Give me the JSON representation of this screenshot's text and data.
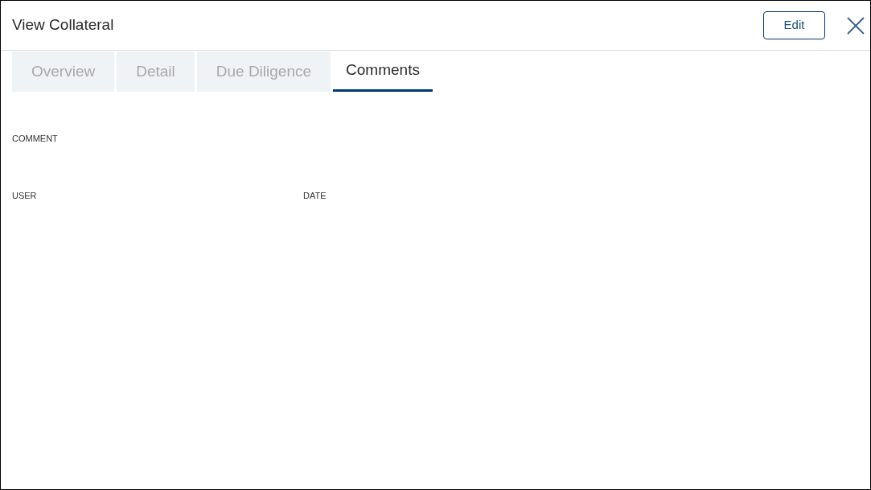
{
  "window": {
    "title": "View Collateral",
    "edit_button": "Edit"
  },
  "tabs": [
    {
      "label": "Overview",
      "selected": false
    },
    {
      "label": "Detail",
      "selected": false
    },
    {
      "label": "Due Diligence",
      "selected": false
    },
    {
      "label": "Comments",
      "selected": true
    }
  ],
  "fields": [
    {
      "label": "COMMENT"
    },
    {
      "label": "USER"
    },
    {
      "label": "DATE"
    }
  ]
}
